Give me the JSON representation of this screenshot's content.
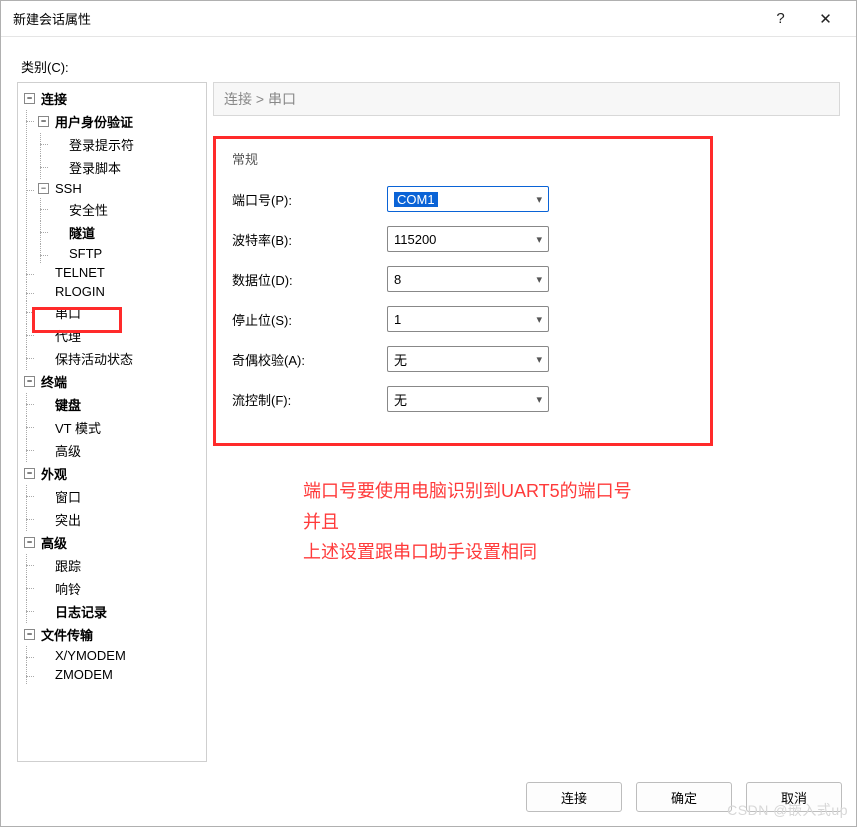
{
  "window": {
    "title": "新建会话属性",
    "help": "?",
    "close": "✕"
  },
  "category_label": "类别(C):",
  "tree": {
    "connection": "连接",
    "auth": "用户身份验证",
    "login_prompt": "登录提示符",
    "login_script": "登录脚本",
    "ssh": "SSH",
    "security": "安全性",
    "tunnel": "隧道",
    "sftp": "SFTP",
    "telnet": "TELNET",
    "rlogin": "RLOGIN",
    "serial": "串口",
    "proxy": "代理",
    "keepalive": "保持活动状态",
    "terminal": "终端",
    "keyboard": "键盘",
    "vt_mode": "VT 模式",
    "advanced1": "高级",
    "appearance": "外观",
    "window_item": "窗口",
    "highlight": "突出",
    "advanced2": "高级",
    "trace": "跟踪",
    "bell": "响铃",
    "logging": "日志记录",
    "file_transfer": "文件传输",
    "xymodem": "X/YMODEM",
    "zmodem": "ZMODEM"
  },
  "breadcrumb": "连接 > 串口",
  "form": {
    "group": "常规",
    "port_label": "端口号(P):",
    "port_value": "COM1",
    "baud_label": "波特率(B):",
    "baud_value": "115200",
    "data_label": "数据位(D):",
    "data_value": "8",
    "stop_label": "停止位(S):",
    "stop_value": "1",
    "parity_label": "奇偶校验(A):",
    "parity_value": "无",
    "flow_label": "流控制(F):",
    "flow_value": "无"
  },
  "note": {
    "line1": "端口号要使用电脑识别到UART5的端口号",
    "line2": "并且",
    "line3": "上述设置跟串口助手设置相同"
  },
  "buttons": {
    "connect": "连接",
    "ok": "确定",
    "cancel": "取消"
  },
  "watermark": "CSDN @嵌入式up"
}
